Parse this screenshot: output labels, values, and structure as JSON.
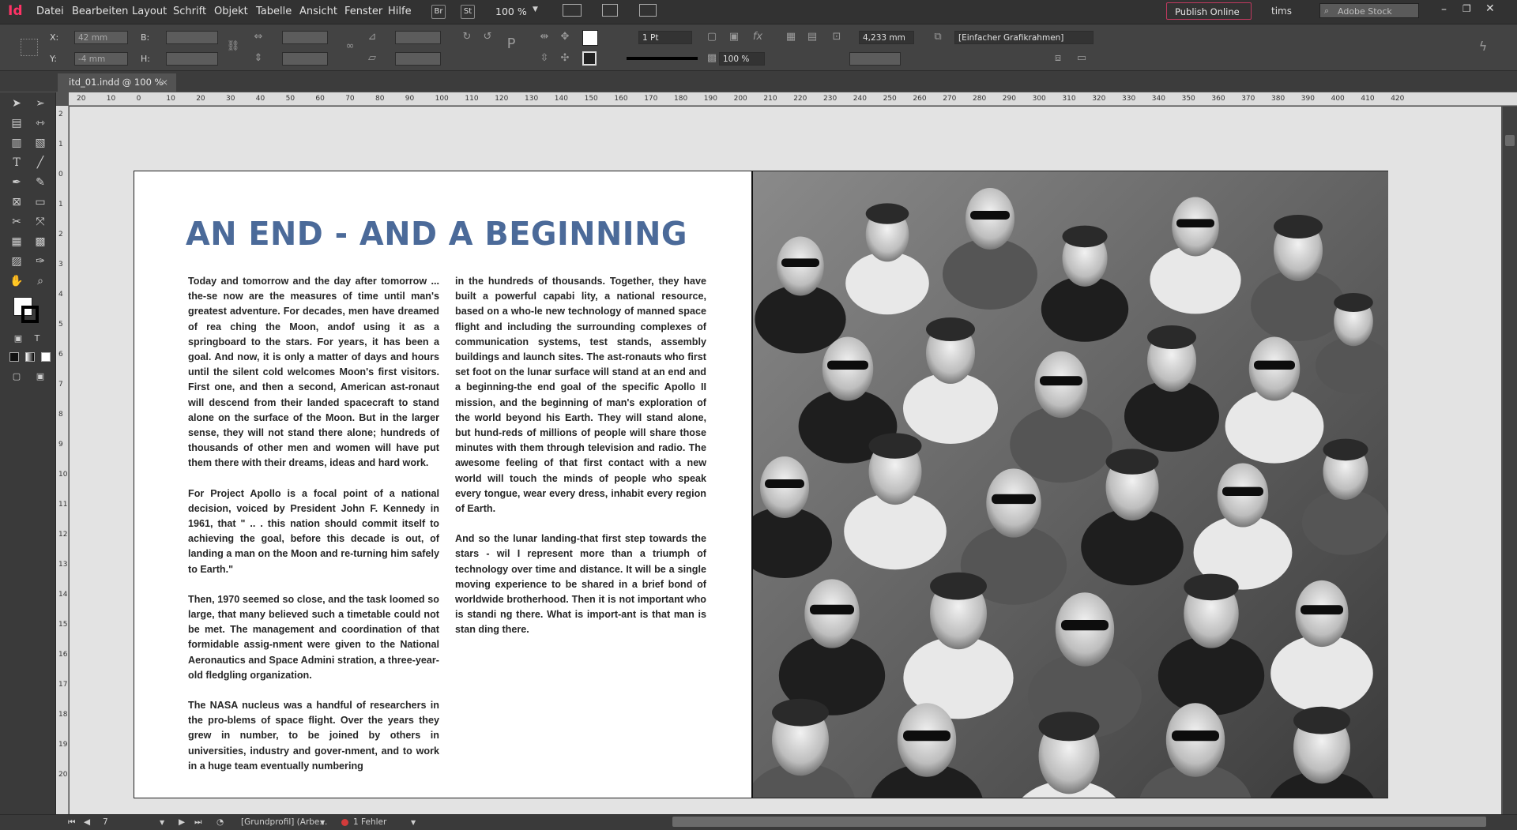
{
  "app": {
    "logo": "Id",
    "menus": [
      "Datei",
      "Bearbeiten",
      "Layout",
      "Schrift",
      "Objekt",
      "Tabelle",
      "Ansicht",
      "Fenster",
      "Hilfe"
    ],
    "bridge_label": "Br",
    "stock_label": "St",
    "zoom": "100 %",
    "publish_label": "Publish Online",
    "user": "tims",
    "search_placeholder": "Adobe Stock",
    "accent_color": "#ff3366"
  },
  "control": {
    "x_label": "X:",
    "y_label": "Y:",
    "w_label": "B:",
    "h_label": "H:",
    "x_value": "42 mm",
    "y_value": "-4 mm",
    "stroke_weight": "1 Pt",
    "opacity": "100 %",
    "offset_value": "4,233 mm",
    "object_style": "[Einfacher Grafikrahmen]"
  },
  "document": {
    "tab_title": "itd_01.indd @ 100 %"
  },
  "rulers": {
    "horizontal": [
      "20",
      "10",
      "0",
      "10",
      "20",
      "30",
      "40",
      "50",
      "60",
      "70",
      "80",
      "90",
      "100",
      "110",
      "120",
      "130",
      "140",
      "150",
      "160",
      "170",
      "180",
      "190",
      "200",
      "210",
      "220",
      "230",
      "240",
      "250",
      "260",
      "270",
      "280",
      "290",
      "300",
      "310",
      "320",
      "330",
      "340",
      "350",
      "360",
      "370",
      "380",
      "390",
      "400",
      "410",
      "420"
    ],
    "vertical": [
      "2",
      "1",
      "0",
      "1",
      "2",
      "3",
      "4",
      "5",
      "6",
      "7",
      "8",
      "9",
      "10",
      "11",
      "12",
      "13",
      "14",
      "15",
      "16",
      "17",
      "18",
      "19",
      "20"
    ]
  },
  "page": {
    "headline": "AN END - AND A BEGINNING",
    "headline_color": "#4b6a99",
    "col1": [
      "Today and tomorrow and the day after tomorrow ... the-se now are the measures of time until man's greatest adventure. For decades, men have dreamed of rea ching the Moon, andof using it as a springboard to the stars. For years, it has been a goal. And now, it is only a matter of days and hours until the silent cold welcomes Moon's first visitors. First one, and then a second, American ast-ronaut will descend from their landed spacecraft to stand alone on the surface of the Moon. But in the larger sense, they will not stand there alone; hundreds of thousands of other men and women will have put them there with their dreams, ideas and hard work.",
      "For Project Apollo is a focal point of a national decision, voiced by President John F. Kennedy in 1961, that \" .. . this nation should commit itself to achieving the goal, before this decade is out, of landing a man on the Moon and re-turning him safely to Earth.\"",
      "Then, 1970 seemed so close, and the task loomed so large, that many believed such a timetable could not be met. The management and coordination of that formidable assig-nment were given to the National Aeronautics and Space Admini stration, a three-year-old fledgling organization.",
      "The NASA nucleus was a handful of researchers in the pro-blems of space flight. Over the years they grew in number, to be joined by others in universities, industry and gover-nment, and to work in a huge team eventually numbering"
    ],
    "col2": [
      "in the hundreds of thousands. Together, they have built a powerful capabi lity, a national resource, based on a who-le new technology of manned space flight and including the surrounding complexes of communication systems, test stands, assembly buildings and launch sites. The ast-ronauts who first set foot on the lunar surface will stand at an end and a beginning-the end goal of the specific Apollo II mission, and the beginning of man's exploration of the world beyond his Earth. They will stand alone, but hund-reds of millions of people will share those minutes with them through television and radio. The awesome feeling of that first contact with a new world will touch the minds of people who speak every tongue, wear every dress, inhabit every region of Earth.",
      "And so the lunar landing-that first step towards the stars - wil I represent more than a triumph of technology over time and distance. It will be a single moving experience to be shared in a brief bond of worldwide brotherhood. Then it is not important who is standi ng there. What is import-ant is that man is stan ding there."
    ]
  },
  "status": {
    "page_number": "7",
    "profile": "[Grundprofil] (Arbe...",
    "errors": "1 Fehler",
    "error_color": "#d23b3b"
  }
}
